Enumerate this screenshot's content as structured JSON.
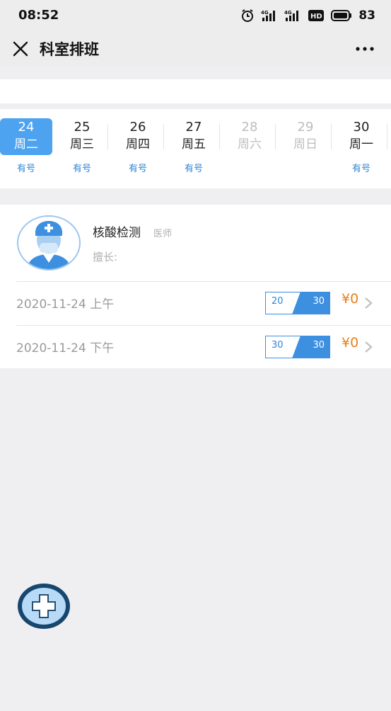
{
  "status_bar": {
    "time": "08:52",
    "battery_pct": "83",
    "icons": [
      "alarm-icon",
      "signal-4g-icon",
      "signal-4g-icon",
      "hd-icon",
      "battery-icon"
    ]
  },
  "nav": {
    "title": "科室排班",
    "close_icon": "close-icon",
    "more_icon": "more-icon"
  },
  "days": [
    {
      "num": "24",
      "weekday": "周二",
      "avail": "有号",
      "selected": true,
      "disabled": false
    },
    {
      "num": "25",
      "weekday": "周三",
      "avail": "有号",
      "selected": false,
      "disabled": false
    },
    {
      "num": "26",
      "weekday": "周四",
      "avail": "有号",
      "selected": false,
      "disabled": false
    },
    {
      "num": "27",
      "weekday": "周五",
      "avail": "有号",
      "selected": false,
      "disabled": false
    },
    {
      "num": "28",
      "weekday": "周六",
      "avail": "",
      "selected": false,
      "disabled": true
    },
    {
      "num": "29",
      "weekday": "周日",
      "avail": "",
      "selected": false,
      "disabled": true
    },
    {
      "num": "30",
      "weekday": "周一",
      "avail": "有号",
      "selected": false,
      "disabled": false
    }
  ],
  "doctor": {
    "name": "核酸检测",
    "title": "医师",
    "skill_label": "擅长:",
    "avatar_icon": "doctor-avatar-icon"
  },
  "slots": [
    {
      "date": "2020-11-24 上午",
      "remaining": "20",
      "total": "30",
      "price": "¥0"
    },
    {
      "date": "2020-11-24 下午",
      "remaining": "30",
      "total": "30",
      "price": "¥0"
    }
  ],
  "fab": {
    "icon": "plus-icon"
  },
  "colors": {
    "accent": "#4da3f0",
    "link_blue": "#2f85d6",
    "price_orange": "#e8801b",
    "page_bg": "#efeff1"
  }
}
